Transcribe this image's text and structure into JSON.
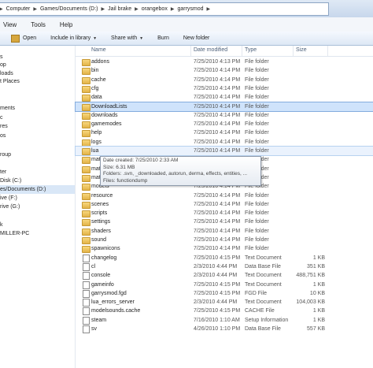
{
  "address": {
    "segments": [
      "Computer",
      "Games/Documents (D:)",
      "Jail brake",
      "orangebox",
      "garrysmod"
    ]
  },
  "menu": [
    "View",
    "Tools",
    "Help"
  ],
  "toolbar": {
    "open": "Open",
    "include": "Include in library",
    "share": "Share with",
    "burn": "Burn",
    "new_folder": "New folder"
  },
  "nav": [
    {
      "label": "s",
      "selected": false
    },
    {
      "label": "op",
      "selected": false
    },
    {
      "label": "loads",
      "selected": false
    },
    {
      "label": "t Places",
      "selected": false
    },
    {
      "label": "",
      "selected": false
    },
    {
      "label": "",
      "selected": false
    },
    {
      "label": "ments",
      "selected": false
    },
    {
      "label": "c",
      "selected": false
    },
    {
      "label": "res",
      "selected": false
    },
    {
      "label": "os",
      "selected": false
    },
    {
      "label": "",
      "selected": false
    },
    {
      "label": "roup",
      "selected": false
    },
    {
      "label": "",
      "selected": false
    },
    {
      "label": "ter",
      "selected": false
    },
    {
      "label": "Disk (C:)",
      "selected": false
    },
    {
      "label": "es/Documents (D:)",
      "selected": true
    },
    {
      "label": "ive (F:)",
      "selected": false
    },
    {
      "label": "rive (G:)",
      "selected": false
    },
    {
      "label": "",
      "selected": false
    },
    {
      "label": "k",
      "selected": false
    },
    {
      "label": "MILLER-PC",
      "selected": false
    }
  ],
  "columns": {
    "name": "Name",
    "date": "Date modified",
    "type": "Type",
    "size": "Size"
  },
  "rows": [
    {
      "name": "addons",
      "date": "7/25/2010 4:13 PM",
      "type": "File folder",
      "size": "",
      "kind": "folder"
    },
    {
      "name": "bin",
      "date": "7/25/2010 4:14 PM",
      "type": "File folder",
      "size": "",
      "kind": "folder"
    },
    {
      "name": "cache",
      "date": "7/25/2010 4:14 PM",
      "type": "File folder",
      "size": "",
      "kind": "folder"
    },
    {
      "name": "cfg",
      "date": "7/25/2010 4:14 PM",
      "type": "File folder",
      "size": "",
      "kind": "folder"
    },
    {
      "name": "data",
      "date": "7/25/2010 4:14 PM",
      "type": "File folder",
      "size": "",
      "kind": "folder"
    },
    {
      "name": "DownloadLists",
      "date": "7/25/2010 4:14 PM",
      "type": "File folder",
      "size": "",
      "kind": "folder",
      "state": "sel"
    },
    {
      "name": "downloads",
      "date": "7/25/2010 4:14 PM",
      "type": "File folder",
      "size": "",
      "kind": "folder"
    },
    {
      "name": "gamemodes",
      "date": "7/25/2010 4:14 PM",
      "type": "File folder",
      "size": "",
      "kind": "folder"
    },
    {
      "name": "help",
      "date": "7/25/2010 4:14 PM",
      "type": "File folder",
      "size": "",
      "kind": "folder"
    },
    {
      "name": "logs",
      "date": "7/25/2010 4:14 PM",
      "type": "File folder",
      "size": "",
      "kind": "folder"
    },
    {
      "name": "lua",
      "date": "7/25/2010 4:14 PM",
      "type": "File folder",
      "size": "",
      "kind": "folder",
      "state": "hov"
    },
    {
      "name": "mat",
      "date": "",
      "type": "File folder",
      "size": "",
      "kind": "folder"
    },
    {
      "name": "mat",
      "date": "",
      "type": "File folder",
      "size": "",
      "kind": "folder"
    },
    {
      "name": "mat",
      "date": "",
      "type": "File folder",
      "size": "",
      "kind": "folder"
    },
    {
      "name": "models",
      "date": "7/25/2010 4:14 PM",
      "type": "File folder",
      "size": "",
      "kind": "folder"
    },
    {
      "name": "resource",
      "date": "7/25/2010 4:14 PM",
      "type": "File folder",
      "size": "",
      "kind": "folder"
    },
    {
      "name": "scenes",
      "date": "7/25/2010 4:14 PM",
      "type": "File folder",
      "size": "",
      "kind": "folder"
    },
    {
      "name": "scripts",
      "date": "7/25/2010 4:14 PM",
      "type": "File folder",
      "size": "",
      "kind": "folder"
    },
    {
      "name": "settings",
      "date": "7/25/2010 4:14 PM",
      "type": "File folder",
      "size": "",
      "kind": "folder"
    },
    {
      "name": "shaders",
      "date": "7/25/2010 4:14 PM",
      "type": "File folder",
      "size": "",
      "kind": "folder"
    },
    {
      "name": "sound",
      "date": "7/25/2010 4:14 PM",
      "type": "File folder",
      "size": "",
      "kind": "folder"
    },
    {
      "name": "spawnicons",
      "date": "7/25/2010 4:14 PM",
      "type": "File folder",
      "size": "",
      "kind": "folder"
    },
    {
      "name": "changelog",
      "date": "7/25/2010 4:15 PM",
      "type": "Text Document",
      "size": "1 KB",
      "kind": "file"
    },
    {
      "name": "cl",
      "date": "2/3/2010 4:44 PM",
      "type": "Data Base File",
      "size": "351 KB",
      "kind": "file"
    },
    {
      "name": "console",
      "date": "2/3/2010 4:44 PM",
      "type": "Text Document",
      "size": "488,751 KB",
      "kind": "file"
    },
    {
      "name": "gameinfo",
      "date": "7/25/2010 4:15 PM",
      "type": "Text Document",
      "size": "1 KB",
      "kind": "file"
    },
    {
      "name": "garrysmod.fgd",
      "date": "7/25/2010 4:15 PM",
      "type": "FGD File",
      "size": "10 KB",
      "kind": "file"
    },
    {
      "name": "lua_errors_server",
      "date": "2/3/2010 4:44 PM",
      "type": "Text Document",
      "size": "104,003 KB",
      "kind": "file"
    },
    {
      "name": "modelsounds.cache",
      "date": "7/25/2010 4:15 PM",
      "type": "CACHE File",
      "size": "1 KB",
      "kind": "file"
    },
    {
      "name": "steam",
      "date": "7/16/2010 1:10 AM",
      "type": "Setup Information",
      "size": "1 KB",
      "kind": "file"
    },
    {
      "name": "sv",
      "date": "4/26/2010 1:10 PM",
      "type": "Data Base File",
      "size": "557 KB",
      "kind": "file"
    }
  ],
  "tooltip": {
    "created": "Date created: 7/25/2010 2:33 AM",
    "size": "Size: 6.31 MB",
    "folders": "Folders: .svn, _downloaded, autorun, derma, effects, entities, ...",
    "files": "Files: functiondump"
  }
}
